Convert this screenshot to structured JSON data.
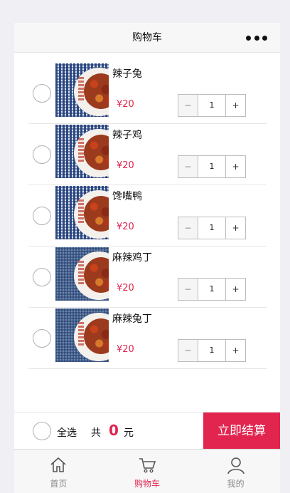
{
  "navbar": {
    "title": "购物车",
    "more_icon": "more-icon"
  },
  "cart": {
    "currency": "¥",
    "items": [
      {
        "name": "辣子兔",
        "price": "¥20",
        "qty": "1"
      },
      {
        "name": "辣子鸡",
        "price": "¥20",
        "qty": "1"
      },
      {
        "name": "馋嘴鸭",
        "price": "¥20",
        "qty": "1"
      },
      {
        "name": "麻辣鸡丁",
        "price": "¥20",
        "qty": "1"
      },
      {
        "name": "麻辣兔丁",
        "price": "¥20",
        "qty": "1"
      }
    ],
    "stepper": {
      "minus": "−",
      "plus": "+"
    }
  },
  "checkout": {
    "select_all": "全选",
    "total_prefix": "共",
    "total_value": "0",
    "total_unit": "元",
    "pay_label": "立即结算"
  },
  "tabbar": {
    "tabs": [
      {
        "label": "首页",
        "icon": "home-icon"
      },
      {
        "label": "购物车",
        "icon": "cart-icon",
        "active": true
      },
      {
        "label": "我的",
        "icon": "user-icon"
      }
    ]
  },
  "colors": {
    "accent": "#e2254f",
    "nav_bg": "#f7f7f7",
    "page_bg": "#efeff4"
  }
}
